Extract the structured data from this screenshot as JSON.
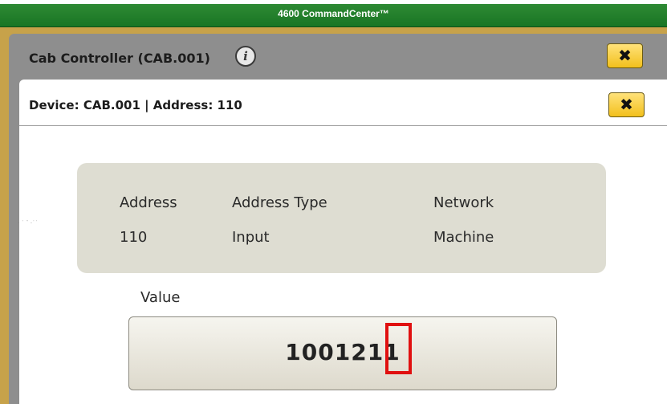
{
  "window": {
    "title": "4600 CommandCenter™"
  },
  "outer_dialog": {
    "title": "Cab Controller (CAB.001)",
    "close_label": "✖"
  },
  "inner_dialog": {
    "title": "Device: CAB.001 | Address: 110",
    "close_label": "✖"
  },
  "info": {
    "address_label": "Address",
    "address_value": "110",
    "type_label": "Address Type",
    "type_value": "Input",
    "network_label": "Network",
    "network_value": "Machine"
  },
  "value": {
    "label": "Value",
    "value": "1001211"
  },
  "colors": {
    "titlebar_green": "#197524",
    "frame_amber": "#c7a24a",
    "close_yellow": "#f2c01c",
    "highlight_red": "#e01010",
    "panel_beige": "#deddd2"
  },
  "icons": {
    "info": "info-icon",
    "close": "close-icon"
  }
}
